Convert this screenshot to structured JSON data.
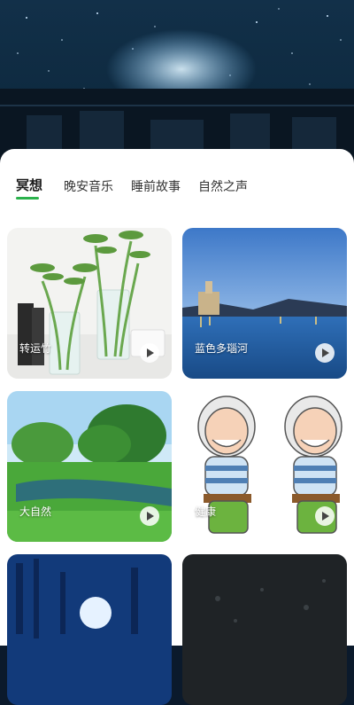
{
  "tabs": [
    {
      "label": "冥想",
      "active": true
    },
    {
      "label": "晚安音乐",
      "active": false
    },
    {
      "label": "睡前故事",
      "active": false
    },
    {
      "label": "自然之声",
      "active": false
    }
  ],
  "accent_color": "#2bb24c",
  "cards": [
    {
      "label": "转运竹",
      "icon": "play-icon"
    },
    {
      "label": "蓝色多瑙河",
      "icon": "play-icon"
    },
    {
      "label": "大自然",
      "icon": "play-icon"
    },
    {
      "label": "健康",
      "icon": "play-icon"
    },
    {
      "label": "",
      "icon": "play-icon"
    },
    {
      "label": "",
      "icon": "play-icon"
    }
  ]
}
